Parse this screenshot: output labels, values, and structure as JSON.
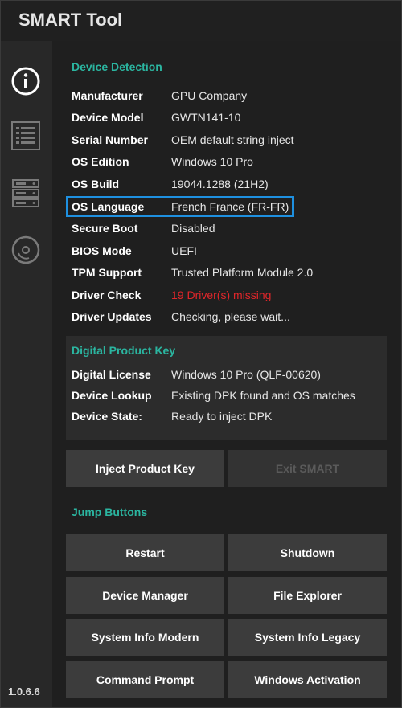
{
  "app": {
    "title": "SMART Tool",
    "version": "1.0.6.6"
  },
  "sidebar": {
    "items": [
      {
        "icon": "info-icon"
      },
      {
        "icon": "list-icon"
      },
      {
        "icon": "server-icon"
      },
      {
        "icon": "disc-icon"
      }
    ]
  },
  "device_detection": {
    "title": "Device Detection",
    "rows": [
      {
        "label": "Manufacturer",
        "value": "GPU Company"
      },
      {
        "label": "Device Model",
        "value": "GWTN141-10"
      },
      {
        "label": "Serial Number",
        "value": "OEM default string inject"
      },
      {
        "label": "OS Edition",
        "value": "Windows 10 Pro"
      },
      {
        "label": "OS Build",
        "value": "19044.1288 (21H2)"
      },
      {
        "label": "OS Language",
        "value": "French France (FR-FR)"
      },
      {
        "label": "Secure Boot",
        "value": "Disabled"
      },
      {
        "label": "BIOS Mode",
        "value": "UEFI"
      },
      {
        "label": "TPM Support",
        "value": "Trusted Platform Module 2.0"
      },
      {
        "label": "Driver Check",
        "value": "19 Driver(s) missing"
      },
      {
        "label": "Driver Updates",
        "value": "Checking, please wait..."
      }
    ]
  },
  "digital_product_key": {
    "title": "Digital Product Key",
    "rows": [
      {
        "label": "Digital License",
        "value": "Windows 10 Pro (QLF-00620)"
      },
      {
        "label": "Device Lookup",
        "value": "Existing DPK found and OS matches"
      },
      {
        "label": "Device State:",
        "value": "Ready to inject DPK"
      }
    ]
  },
  "actions": {
    "inject": "Inject Product Key",
    "exit": "Exit SMART"
  },
  "jump_buttons": {
    "title": "Jump Buttons",
    "buttons": [
      "Restart",
      "Shutdown",
      "Device Manager",
      "File Explorer",
      "System Info Modern",
      "System Info Legacy",
      "Command Prompt",
      "Windows Activation"
    ]
  },
  "colors": {
    "accent": "#2bb5a0",
    "error": "#e0262a",
    "highlight": "#1e90e0"
  }
}
